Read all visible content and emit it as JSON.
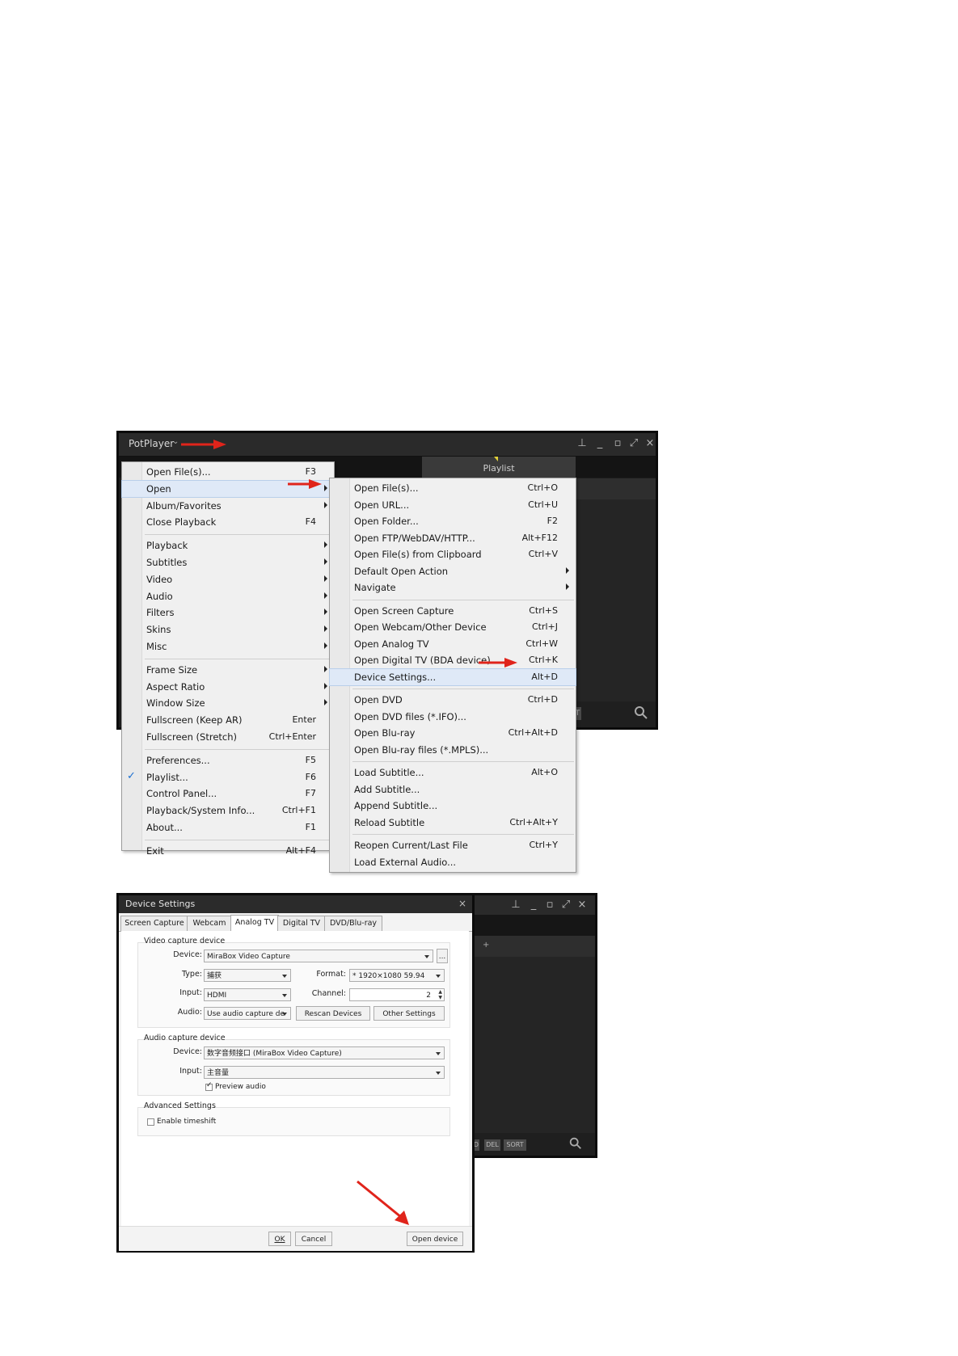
{
  "player": {
    "title": "PotPlayer",
    "playlist_tab": "Playlist",
    "sort_button": "ORT",
    "window2_buttons": [
      "D",
      "DEL",
      "SORT"
    ],
    "plus": "+"
  },
  "main_menu": {
    "items": [
      {
        "label": "Open File(s)...",
        "shortcut": "F3",
        "submenu": false
      },
      {
        "label": "Open",
        "shortcut": "",
        "submenu": true,
        "highlight": true
      },
      {
        "label": "Album/Favorites",
        "shortcut": "",
        "submenu": true
      },
      {
        "label": "Close Playback",
        "shortcut": "F4",
        "submenu": false
      },
      {
        "label": "Playback",
        "shortcut": "",
        "submenu": true
      },
      {
        "label": "Subtitles",
        "shortcut": "",
        "submenu": true
      },
      {
        "label": "Video",
        "shortcut": "",
        "submenu": true
      },
      {
        "label": "Audio",
        "shortcut": "",
        "submenu": true
      },
      {
        "label": "Filters",
        "shortcut": "",
        "submenu": true
      },
      {
        "label": "Skins",
        "shortcut": "",
        "submenu": true
      },
      {
        "label": "Misc",
        "shortcut": "",
        "submenu": true
      },
      {
        "label": "Frame Size",
        "shortcut": "",
        "submenu": true
      },
      {
        "label": "Aspect Ratio",
        "shortcut": "",
        "submenu": true
      },
      {
        "label": "Window Size",
        "shortcut": "",
        "submenu": true
      },
      {
        "label": "Fullscreen (Keep AR)",
        "shortcut": "Enter",
        "submenu": false
      },
      {
        "label": "Fullscreen (Stretch)",
        "shortcut": "Ctrl+Enter",
        "submenu": false
      },
      {
        "label": "Preferences...",
        "shortcut": "F5",
        "submenu": false
      },
      {
        "label": "Playlist...",
        "shortcut": "F6",
        "submenu": false,
        "checked": true
      },
      {
        "label": "Control Panel...",
        "shortcut": "F7",
        "submenu": false
      },
      {
        "label": "Playback/System Info...",
        "shortcut": "Ctrl+F1",
        "submenu": false
      },
      {
        "label": "About...",
        "shortcut": "F1",
        "submenu": false
      },
      {
        "label": "Exit",
        "shortcut": "Alt+F4",
        "submenu": false
      }
    ]
  },
  "open_menu": {
    "items": [
      {
        "label": "Open File(s)...",
        "shortcut": "Ctrl+O",
        "submenu": false
      },
      {
        "label": "Open URL...",
        "shortcut": "Ctrl+U",
        "submenu": false
      },
      {
        "label": "Open Folder...",
        "shortcut": "F2",
        "submenu": false
      },
      {
        "label": "Open FTP/WebDAV/HTTP...",
        "shortcut": "Alt+F12",
        "submenu": false
      },
      {
        "label": "Open File(s) from Clipboard",
        "shortcut": "Ctrl+V",
        "submenu": false
      },
      {
        "label": "Default Open Action",
        "shortcut": "",
        "submenu": true
      },
      {
        "label": "Navigate",
        "shortcut": "",
        "submenu": true
      },
      {
        "label": "Open Screen Capture",
        "shortcut": "Ctrl+S",
        "submenu": false
      },
      {
        "label": "Open Webcam/Other Device",
        "shortcut": "Ctrl+J",
        "submenu": false
      },
      {
        "label": "Open Analog TV",
        "shortcut": "Ctrl+W",
        "submenu": false
      },
      {
        "label": "Open Digital TV (BDA device)",
        "shortcut": "Ctrl+K",
        "submenu": false
      },
      {
        "label": "Device Settings...",
        "shortcut": "Alt+D",
        "submenu": false,
        "highlight": true
      },
      {
        "label": "Open DVD",
        "shortcut": "Ctrl+D",
        "submenu": false
      },
      {
        "label": "Open DVD files (*.IFO)...",
        "shortcut": "",
        "submenu": false
      },
      {
        "label": "Open Blu-ray",
        "shortcut": "Ctrl+Alt+D",
        "submenu": false
      },
      {
        "label": "Open Blu-ray files (*.MPLS)...",
        "shortcut": "",
        "submenu": false
      },
      {
        "label": "Load Subtitle...",
        "shortcut": "Alt+O",
        "submenu": false
      },
      {
        "label": "Add Subtitle...",
        "shortcut": "",
        "submenu": false
      },
      {
        "label": "Append Subtitle...",
        "shortcut": "",
        "submenu": false
      },
      {
        "label": "Reload Subtitle",
        "shortcut": "Ctrl+Alt+Y",
        "submenu": false
      },
      {
        "label": "Reopen Current/Last File",
        "shortcut": "Ctrl+Y",
        "submenu": false
      },
      {
        "label": "Load External Audio...",
        "shortcut": "",
        "submenu": false
      }
    ]
  },
  "dialog": {
    "title": "Device Settings",
    "tabs": [
      "Screen Capture",
      "Webcam",
      "Analog TV",
      "Digital TV",
      "DVD/Blu-ray"
    ],
    "active_tab": "Analog TV",
    "video": {
      "group_title": "Video capture device",
      "device_label": "Device:",
      "device_value": "MiraBox Video Capture",
      "browse": "...",
      "type_label": "Type:",
      "type_value": "捕获",
      "format_label": "Format:",
      "format_value": "* 1920×1080 59.94",
      "input_label": "Input:",
      "input_value": "HDMI",
      "channel_label": "Channel:",
      "channel_value": "2",
      "audio_label": "Audio:",
      "audio_value": "Use audio capture de",
      "rescan": "Rescan Devices",
      "other": "Other Settings"
    },
    "audio": {
      "group_title": "Audio capture device",
      "device_label": "Device:",
      "device_value": "数字音频接口 (MiraBox Video Capture)",
      "input_label": "Input:",
      "input_value": "主音量",
      "preview": "Preview audio"
    },
    "advanced": {
      "group_title": "Advanced Settings",
      "timeshift": "Enable timeshift"
    },
    "footer": {
      "ok": "OK",
      "cancel": "Cancel",
      "open_device": "Open device"
    }
  },
  "colors": {
    "arrow": "#e0241b",
    "menu_bg": "#f0f0f0",
    "highlight": "#dfe9f7",
    "window_dark": "#1c1c1c"
  }
}
